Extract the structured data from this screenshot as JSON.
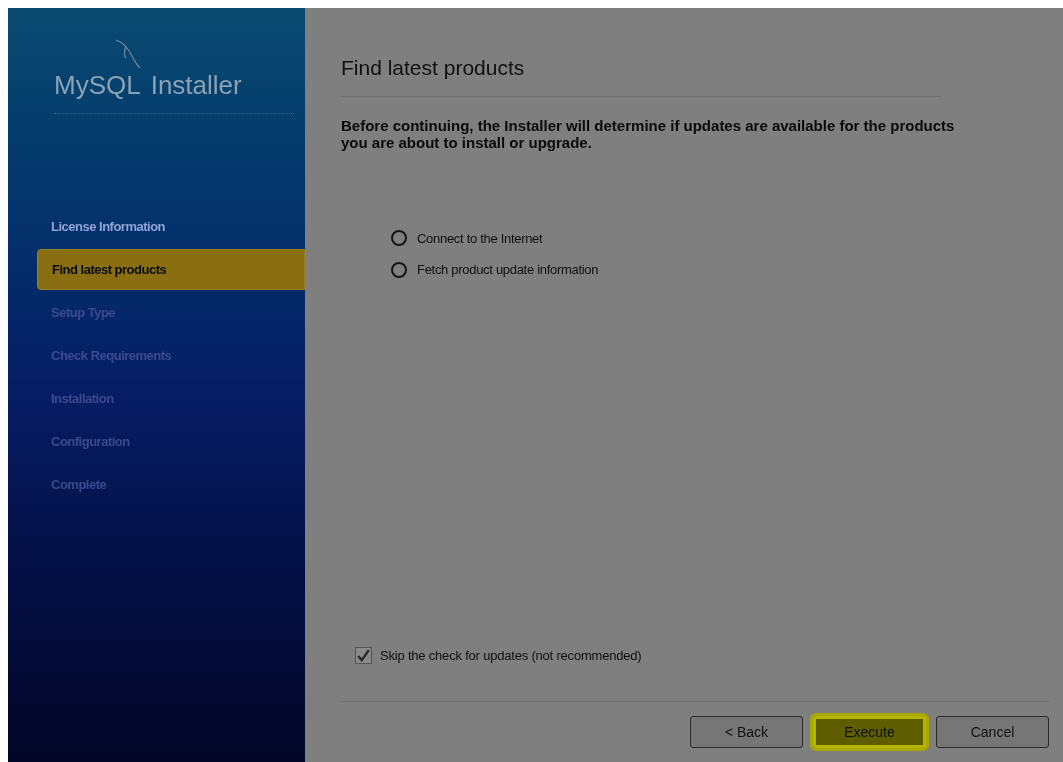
{
  "sidebar": {
    "logo_text": "MySQL",
    "logo_suffix": "Installer",
    "items": [
      {
        "label": "License Information",
        "selected": false
      },
      {
        "label": "Find latest products",
        "selected": true
      },
      {
        "label": "Setup Type",
        "selected": false
      },
      {
        "label": "Check Requirements",
        "selected": false
      },
      {
        "label": "Installation",
        "selected": false
      },
      {
        "label": "Configuration",
        "selected": false
      },
      {
        "label": "Complete",
        "selected": false
      }
    ]
  },
  "page": {
    "title": "Find latest products",
    "description": "Before continuing, the Installer will determine if updates are available for the products you are about to install or upgrade.",
    "steps": [
      {
        "label": "Connect to the Internet",
        "selected": false
      },
      {
        "label": "Fetch product update information",
        "selected": false
      }
    ],
    "skip_checkbox": {
      "label": "Skip the check for updates (not recommended)",
      "checked": true,
      "disabled": true
    }
  },
  "buttons": [
    {
      "label": "< Back",
      "highlighted": false
    },
    {
      "label": "Execute",
      "highlighted": true
    },
    {
      "label": "Cancel",
      "highlighted": false
    }
  ]
}
